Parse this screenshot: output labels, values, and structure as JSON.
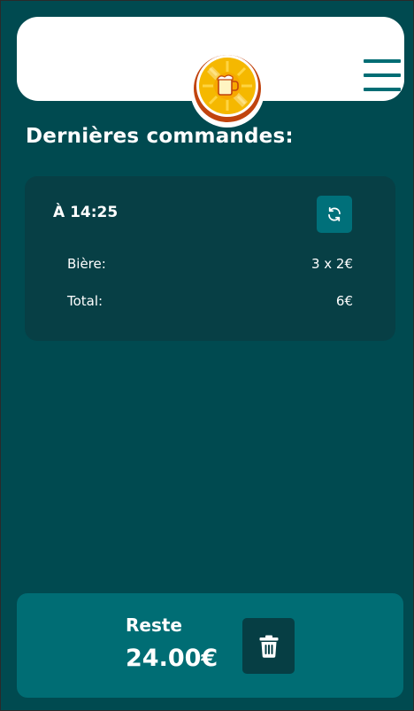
{
  "header": {
    "logo_icon": "beer-coin-logo",
    "menu_icon": "hamburger-menu-icon"
  },
  "orders": {
    "title": "Dernières commandes:",
    "items": [
      {
        "time": "À 14:25",
        "refresh_icon": "refresh-icon",
        "lines": [
          {
            "label": "Bière:",
            "value": "3 x 2€"
          },
          {
            "label": "Total:",
            "value": "6€"
          }
        ]
      }
    ]
  },
  "footer": {
    "label": "Reste",
    "amount": "24.00€",
    "delete_icon": "trash-icon"
  },
  "colors": {
    "background": "#004a50",
    "card": "#073f45",
    "accent": "#006d74",
    "header": "#ffffff",
    "logo_gold": "#f5b800",
    "logo_rim": "#c1440e"
  }
}
